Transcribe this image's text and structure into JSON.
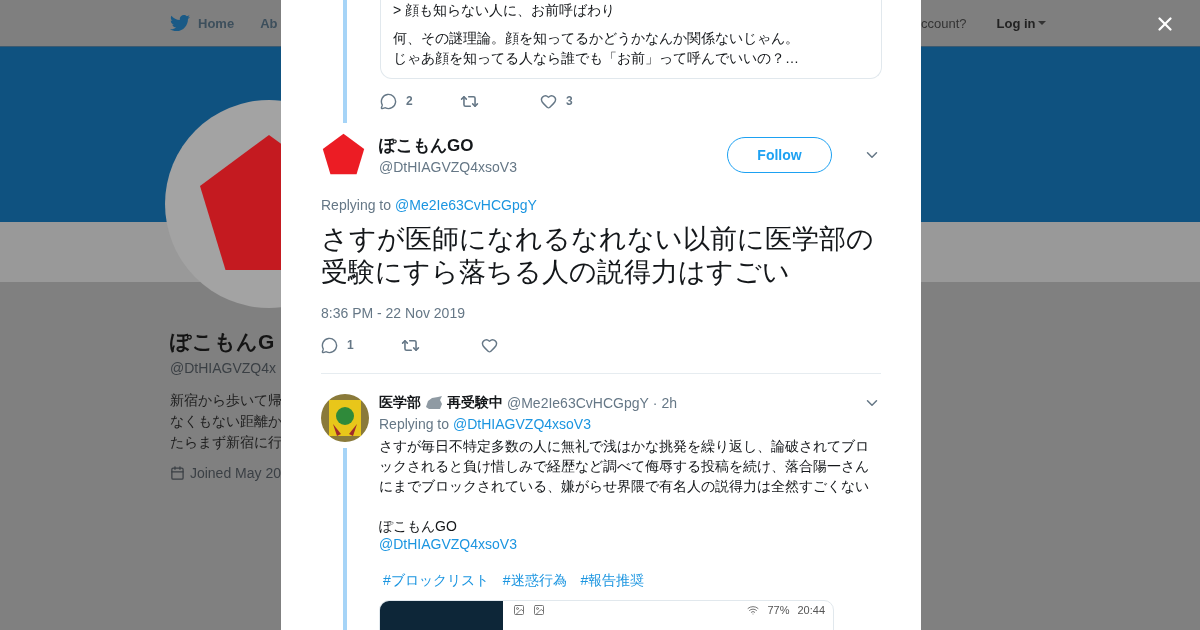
{
  "nav": {
    "home": "Home",
    "about": "Ab",
    "account": "ccount?",
    "login": "Log in"
  },
  "profile": {
    "name": "ぽこもんG",
    "handle": "@DtHIAGVZQ4x",
    "bio": [
      "新宿から歩いて帰",
      "なくもない距離か",
      "たらまず新宿に行"
    ],
    "joined": "Joined May 20"
  },
  "parent_tweet": {
    "quote_paragraphs": [
      [
        "> 顔も知らない人に、お前呼ばわり"
      ],
      [
        "何、その謎理論。顔を知ってるかどうかなんか関係ないじゃん。",
        "じゃあ顔を知ってる人なら誰でも「お前」って呼んでいいの？…"
      ]
    ],
    "replies": "2",
    "likes": "3"
  },
  "main_tweet": {
    "name": "ぽこもんGO",
    "handle": "@DtHIAGVZQ4xsoV3",
    "follow": "Follow",
    "replying_label": "Replying to",
    "replying_to": "@Me2Ie63CvHCGpgY",
    "text": "さすが医師になれるなれない以前に医学部の受験にすら落ちる人の説得力はすごい",
    "time": "8:36 PM - 22 Nov 2019",
    "replies": "1"
  },
  "reply_tweet": {
    "name_before": "医学部",
    "name_after": "再受験中",
    "handle": "@Me2Ie63CvHCGpgY",
    "time": "· 2h",
    "replying_label": "Replying to",
    "replying_to": "@DtHIAGVZQ4xsoV3",
    "body": "さすが毎日不特定多数の人に無礼で浅はかな挑発を繰り返し、論破されてブロックされると負け惜しみで経歴など調べて侮辱する投稿を続け、落合陽一さんにまでブロックされている、嫌がらせ界隈で有名人の説得力は全然すごくない",
    "mention_name": "ぽこもんGO",
    "mention_link": "@DtHIAGVZQ4xsoV3",
    "hashtags": [
      "#ブロックリスト",
      "#迷惑行為",
      "#報告推奨"
    ],
    "screenshot": {
      "battery": "77%",
      "clock": "20:44"
    }
  }
}
